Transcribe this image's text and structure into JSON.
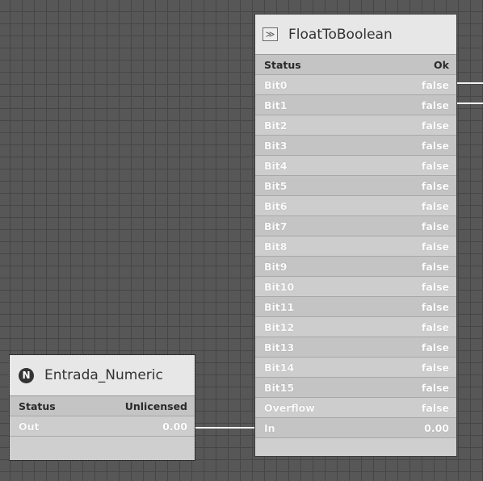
{
  "float_node": {
    "title": "FloatToBoolean",
    "icon": "double-arrow-icon",
    "icon_glyph": "≫",
    "slots": [
      {
        "label": "Status",
        "value": "Ok"
      },
      {
        "label": "Bit0",
        "value": "false"
      },
      {
        "label": "Bit1",
        "value": "false"
      },
      {
        "label": "Bit2",
        "value": "false"
      },
      {
        "label": "Bit3",
        "value": "false"
      },
      {
        "label": "Bit4",
        "value": "false"
      },
      {
        "label": "Bit5",
        "value": "false"
      },
      {
        "label": "Bit6",
        "value": "false"
      },
      {
        "label": "Bit7",
        "value": "false"
      },
      {
        "label": "Bit8",
        "value": "false"
      },
      {
        "label": "Bit9",
        "value": "false"
      },
      {
        "label": "Bit10",
        "value": "false"
      },
      {
        "label": "Bit11",
        "value": "false"
      },
      {
        "label": "Bit12",
        "value": "false"
      },
      {
        "label": "Bit13",
        "value": "false"
      },
      {
        "label": "Bit14",
        "value": "false"
      },
      {
        "label": "Bit15",
        "value": "false"
      },
      {
        "label": "Overflow",
        "value": "false"
      },
      {
        "label": "In",
        "value": "0.00"
      }
    ]
  },
  "numeric_node": {
    "title": "Entrada_Numeric",
    "icon": "n-circle-icon",
    "icon_glyph": "N",
    "slots": [
      {
        "label": "Status",
        "value": "Unlicensed"
      },
      {
        "label": "Out",
        "value": "0.00"
      }
    ]
  },
  "colors": {
    "canvas": "#575757",
    "grid": "#464646",
    "wire": "#f2f2f2",
    "node_body": "#cfcfcf",
    "node_header": "#e7e7e7"
  }
}
